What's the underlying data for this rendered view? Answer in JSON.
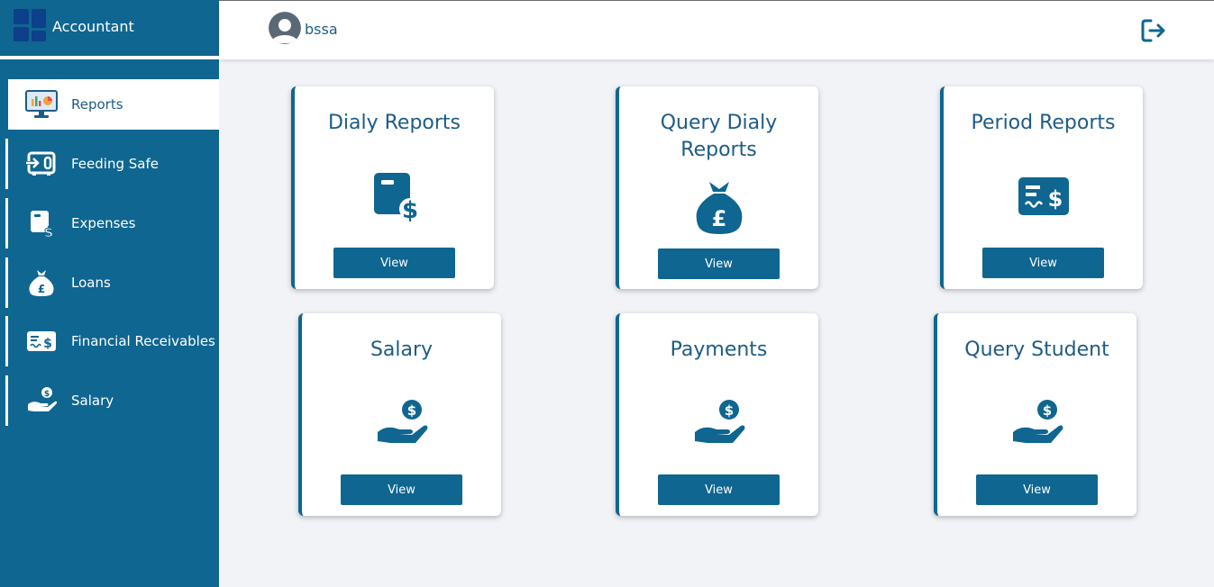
{
  "sidebar": {
    "brand": "Accountant",
    "items": [
      {
        "label": "Reports",
        "icon": "monitor-chart-icon",
        "active": true
      },
      {
        "label": "Feeding Safe",
        "icon": "safe-deposit-icon",
        "active": false
      },
      {
        "label": "Expenses",
        "icon": "expense-document-icon",
        "active": false
      },
      {
        "label": "Loans",
        "icon": "money-bag-icon",
        "active": false
      },
      {
        "label": "Financial Receivables",
        "icon": "check-dollar-icon",
        "active": false
      },
      {
        "label": "Salary",
        "icon": "hand-coin-icon",
        "active": false
      }
    ]
  },
  "header": {
    "username": "bssa"
  },
  "cards": [
    {
      "title": "Dialy Reports",
      "button": "View",
      "icon": "expense-document-icon"
    },
    {
      "title": "Query Dialy Reports",
      "button": "View",
      "icon": "money-bag-icon"
    },
    {
      "title": "Period Reports",
      "button": "View",
      "icon": "check-dollar-icon"
    },
    {
      "title": "Salary",
      "button": "View",
      "icon": "hand-coin-icon"
    },
    {
      "title": "Payments",
      "button": "View",
      "icon": "hand-coin-icon"
    },
    {
      "title": "Query Student",
      "button": "View",
      "icon": "hand-coin-icon"
    }
  ],
  "colors": {
    "primary": "#0f6690",
    "text": "#1d5c86",
    "background": "#f2f3f7"
  }
}
